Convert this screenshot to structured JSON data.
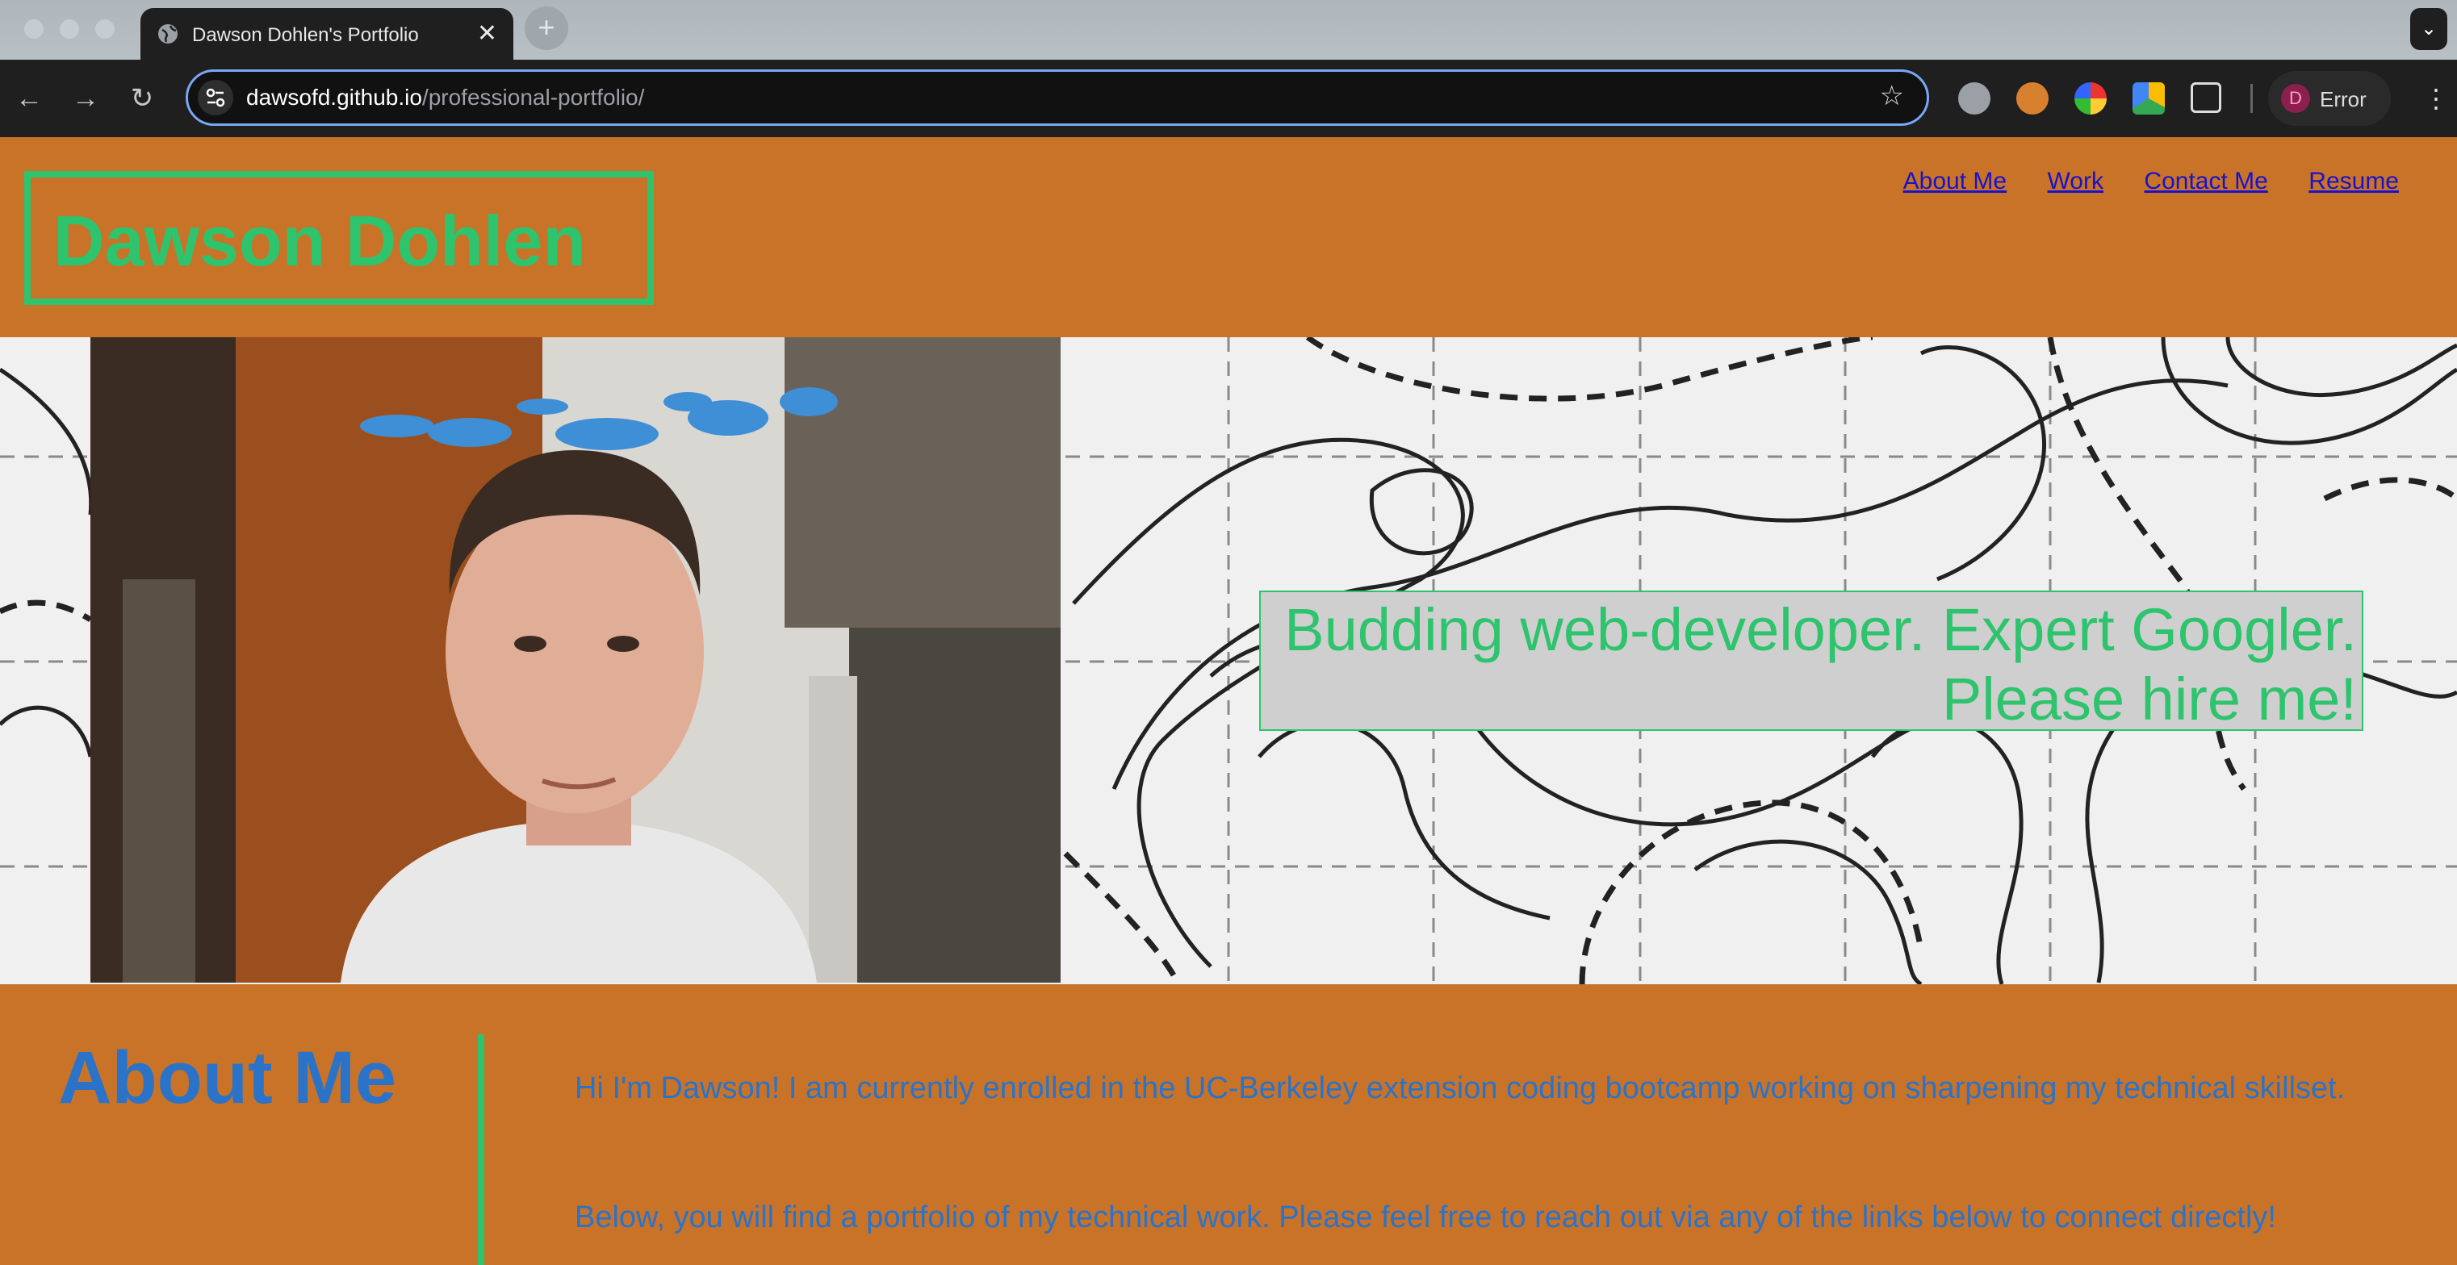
{
  "browser": {
    "tab_title": "Dawson Dohlen's Portfolio",
    "tab_close": "✕",
    "new_tab": "+",
    "url_host": "dawsofd.github.io",
    "url_path": "/professional-portfolio/",
    "profile_initial": "D",
    "profile_status": "Error",
    "icons": [
      "back-arrow-icon",
      "forward-arrow-icon",
      "reload-icon",
      "site-settings-icon",
      "bookmark-star-icon",
      "extensions-puzzle-icon",
      "menu-kebab-icon"
    ]
  },
  "header": {
    "name": "Dawson Dohlen",
    "nav": [
      "About Me",
      "Work",
      "Contact Me",
      "Resume"
    ]
  },
  "hero": {
    "tagline_line1": "Budding web-developer. Expert Googler.",
    "tagline_line2": "Please hire me!"
  },
  "about": {
    "heading": "About Me",
    "p1": "Hi I'm Dawson! I am currently enrolled in the UC-Berkeley extension coding bootcamp working on sharpening my technical skillset.",
    "p2": "Below, you will find a portfolio of my technical work. Please feel free to reach out via any of the links below to connect directly!"
  },
  "colors": {
    "page_bg": "#c97329",
    "accent_green": "#2ec36d",
    "text_blue": "#2a73c8",
    "link_blue": "#1a12c9"
  }
}
